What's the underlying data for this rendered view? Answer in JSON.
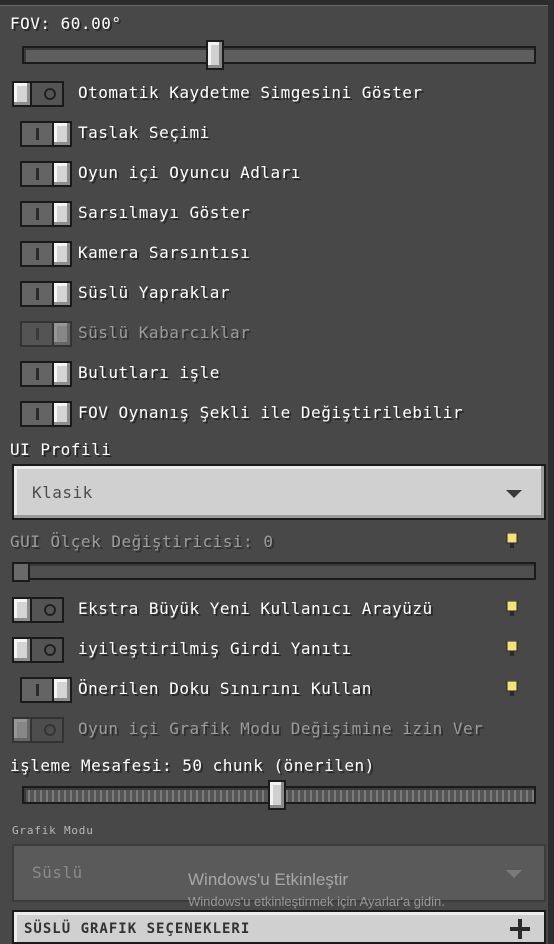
{
  "fov": {
    "label": "FOV: 60.00°",
    "value_fraction": 0.37
  },
  "toggles": [
    {
      "label": "Otomatik Kaydetme Simgesini Göster",
      "state": "off"
    },
    {
      "label": "Taslak Seçimi",
      "state": "on"
    },
    {
      "label": "Oyun içi Oyuncu Adları",
      "state": "on"
    },
    {
      "label": "Sarsılmayı Göster",
      "state": "on"
    },
    {
      "label": "Kamera Sarsıntısı",
      "state": "on"
    },
    {
      "label": "Süslü Yapraklar",
      "state": "on"
    },
    {
      "label": "Süslü Kabarcıklar",
      "state": "on",
      "disabled": true
    },
    {
      "label": "Bulutları işle",
      "state": "on"
    },
    {
      "label": "FOV Oynanış Şekli ile Değiştirilebilir",
      "state": "on"
    }
  ],
  "ui_profile": {
    "label": "UI Profili",
    "selected": "Klasik"
  },
  "gui_scale": {
    "label": "GUI Ölçek Değiştiricisi: 0",
    "value_fraction": 0.0
  },
  "toggles2": [
    {
      "label": "Ekstra Büyük Yeni Kullanıcı Arayüzü",
      "state": "off",
      "info": true
    },
    {
      "label": "iyileştirilmiş Girdi Yanıtı",
      "state": "off",
      "info": true
    },
    {
      "label": "Önerilen Doku Sınırını Kullan",
      "state": "on",
      "info": true
    },
    {
      "label": "Oyun içi Grafik Modu Değişimine izin Ver",
      "state": "off",
      "disabled": true
    }
  ],
  "render_distance": {
    "label": "işleme Mesafesi: 50 chunk (önerilen)",
    "value_fraction": 0.5
  },
  "graphics_mode": {
    "label": "Grafik Modu",
    "selected": "Süslü"
  },
  "watermark": {
    "title": "Windows'u Etkinleştir",
    "subtitle": "Windows'u etkinleştirmek için Ayarlar'a gidin."
  },
  "fancy_section": {
    "label": "SÜSLÜ GRAFIK SEÇENEKLERI"
  },
  "colors": {
    "background": "#484848",
    "control_light": "#d0d0d0",
    "info_icon": "#f2e27a"
  }
}
